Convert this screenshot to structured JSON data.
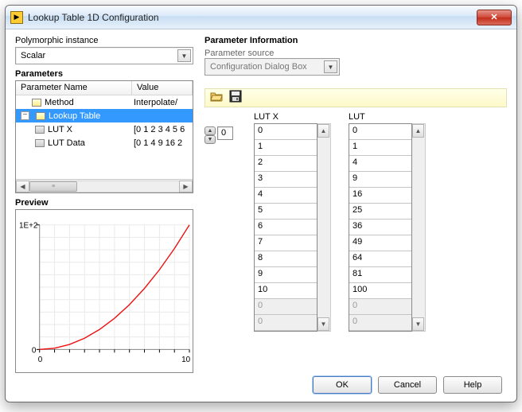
{
  "window": {
    "title": "Lookup Table 1D Configuration",
    "close": "✕"
  },
  "poly": {
    "label": "Polymorphic instance",
    "value": "Scalar"
  },
  "params": {
    "heading": "Parameters",
    "col_name": "Parameter Name",
    "col_value": "Value",
    "rows": [
      {
        "name": "Method",
        "value": "Interpolate/"
      },
      {
        "name": "Lookup Table",
        "value": ""
      },
      {
        "name": "LUT X",
        "value": "[0 1 2 3 4 5 6"
      },
      {
        "name": "LUT Data",
        "value": "[0 1 4 9 16 2"
      }
    ]
  },
  "preview": {
    "label": "Preview",
    "ymax": "1E+2",
    "ymin": "0",
    "xmin": "0",
    "xmax": "10"
  },
  "chart_data": {
    "type": "line",
    "title": "",
    "xlabel": "",
    "ylabel": "",
    "xlim": [
      0,
      10
    ],
    "ylim": [
      0,
      100
    ],
    "x": [
      0,
      1,
      2,
      3,
      4,
      5,
      6,
      7,
      8,
      9,
      10
    ],
    "y": [
      0,
      1,
      4,
      9,
      16,
      25,
      36,
      49,
      64,
      81,
      100
    ]
  },
  "paraminfo": {
    "heading": "Parameter Information",
    "source_label": "Parameter source",
    "source_value": "Configuration Dialog Box"
  },
  "idx": "0",
  "lutx": {
    "label": "LUT X",
    "values": [
      "0",
      "1",
      "2",
      "3",
      "4",
      "5",
      "6",
      "7",
      "8",
      "9",
      "10"
    ],
    "disabled": [
      "0",
      "0"
    ]
  },
  "lut": {
    "label": "LUT",
    "values": [
      "0",
      "1",
      "4",
      "9",
      "16",
      "25",
      "36",
      "49",
      "64",
      "81",
      "100"
    ],
    "disabled": [
      "0",
      "0"
    ]
  },
  "buttons": {
    "ok": "OK",
    "cancel": "Cancel",
    "help": "Help"
  }
}
